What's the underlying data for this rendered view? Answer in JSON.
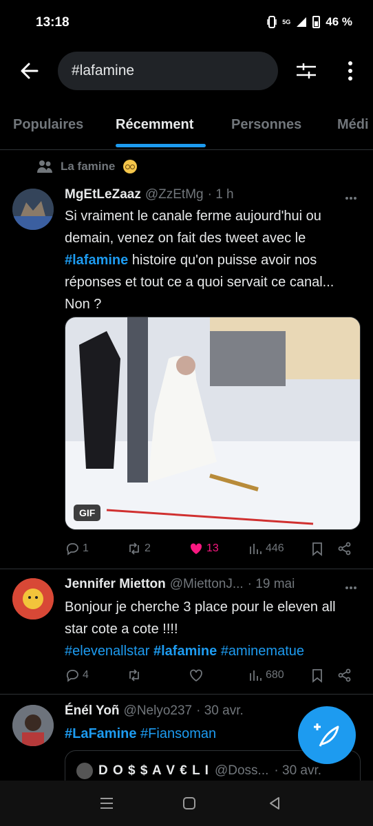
{
  "status": {
    "time": "13:18",
    "network": "5G",
    "battery": "46 %"
  },
  "search": {
    "query": "#lafamine"
  },
  "tabs": [
    {
      "label": "Populaires"
    },
    {
      "label": "Récemment"
    },
    {
      "label": "Personnes"
    },
    {
      "label": "Médi"
    }
  ],
  "tweets": [
    {
      "community": "La famine",
      "name": "MgEtLeZaaz",
      "handle": "@ZzEtMg",
      "time": "· 1 h",
      "text_before": "Si vraiment le canale ferme aujourd'hui ou demain, venez on fait des tweet avec le ",
      "hashtag": "#lafamine",
      "text_after": "  histoire qu'on puisse avoir nos réponses et tout ce a quoi servait ce canal... Non ?",
      "media_badge": "GIF",
      "replies": "1",
      "retweets": "2",
      "likes": "13",
      "views": "446"
    },
    {
      "name": "Jennifer Mietton",
      "handle": "@MiettonJ...",
      "time": "· 19 mai",
      "text": "Bonjour je cherche 3 place pour le eleven all star cote a cote !!!!",
      "hashtags": [
        "#elevenallstar",
        "#lafamine",
        "#aminematue"
      ],
      "replies": "4",
      "retweets": "",
      "likes": "",
      "views": "680"
    },
    {
      "name": "Énél Yoñ",
      "handle": "@Nelyo237",
      "time": "· 30 avr.",
      "hashtags": [
        "#LaFamine",
        "#Fiansoman"
      ],
      "quote": {
        "name": "D O $ $ A V € L I",
        "handle": "@Doss...",
        "time": "· 30 avr."
      }
    }
  ],
  "colors": {
    "accent": "#1d9bf0",
    "like": "#f91880",
    "muted": "#71767b",
    "background": "#000000"
  }
}
